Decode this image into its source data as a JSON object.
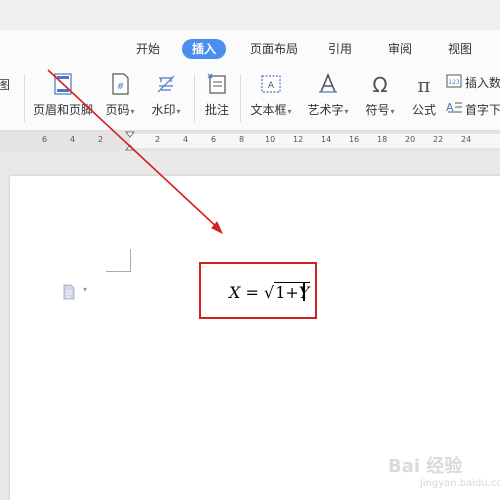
{
  "tabs": [
    {
      "label": "开始"
    },
    {
      "label": "插入",
      "active": true
    },
    {
      "label": "页面布局"
    },
    {
      "label": "引用"
    },
    {
      "label": "审阅"
    },
    {
      "label": "视图"
    }
  ],
  "ribbon": {
    "partial_left_top": "图",
    "header_footer": "页眉和页脚",
    "page_number": "页码",
    "watermark": "水印",
    "comment": "批注",
    "textbox": "文本框",
    "wordart": "艺术字",
    "symbol": "符号",
    "formula": "公式",
    "insert_number": "插入数",
    "dropcap": "首字下"
  },
  "ruler": {
    "left_numbers": [
      "6",
      "4",
      "2"
    ],
    "right_numbers": [
      "2",
      "4",
      "6",
      "8",
      "10",
      "12",
      "14",
      "16",
      "18",
      "20",
      "22",
      "24"
    ]
  },
  "equation": {
    "lhs": "X",
    "eq": "=",
    "radicand_1": "1",
    "plus": "+",
    "radicand_var": "Y"
  },
  "colors": {
    "accent_tab": "#4a8ef0",
    "highlight_border": "#d42020",
    "arrow": "#d42020"
  },
  "watermark": {
    "text": "Bai 经验",
    "sub": "jingyan.baidu.com"
  }
}
